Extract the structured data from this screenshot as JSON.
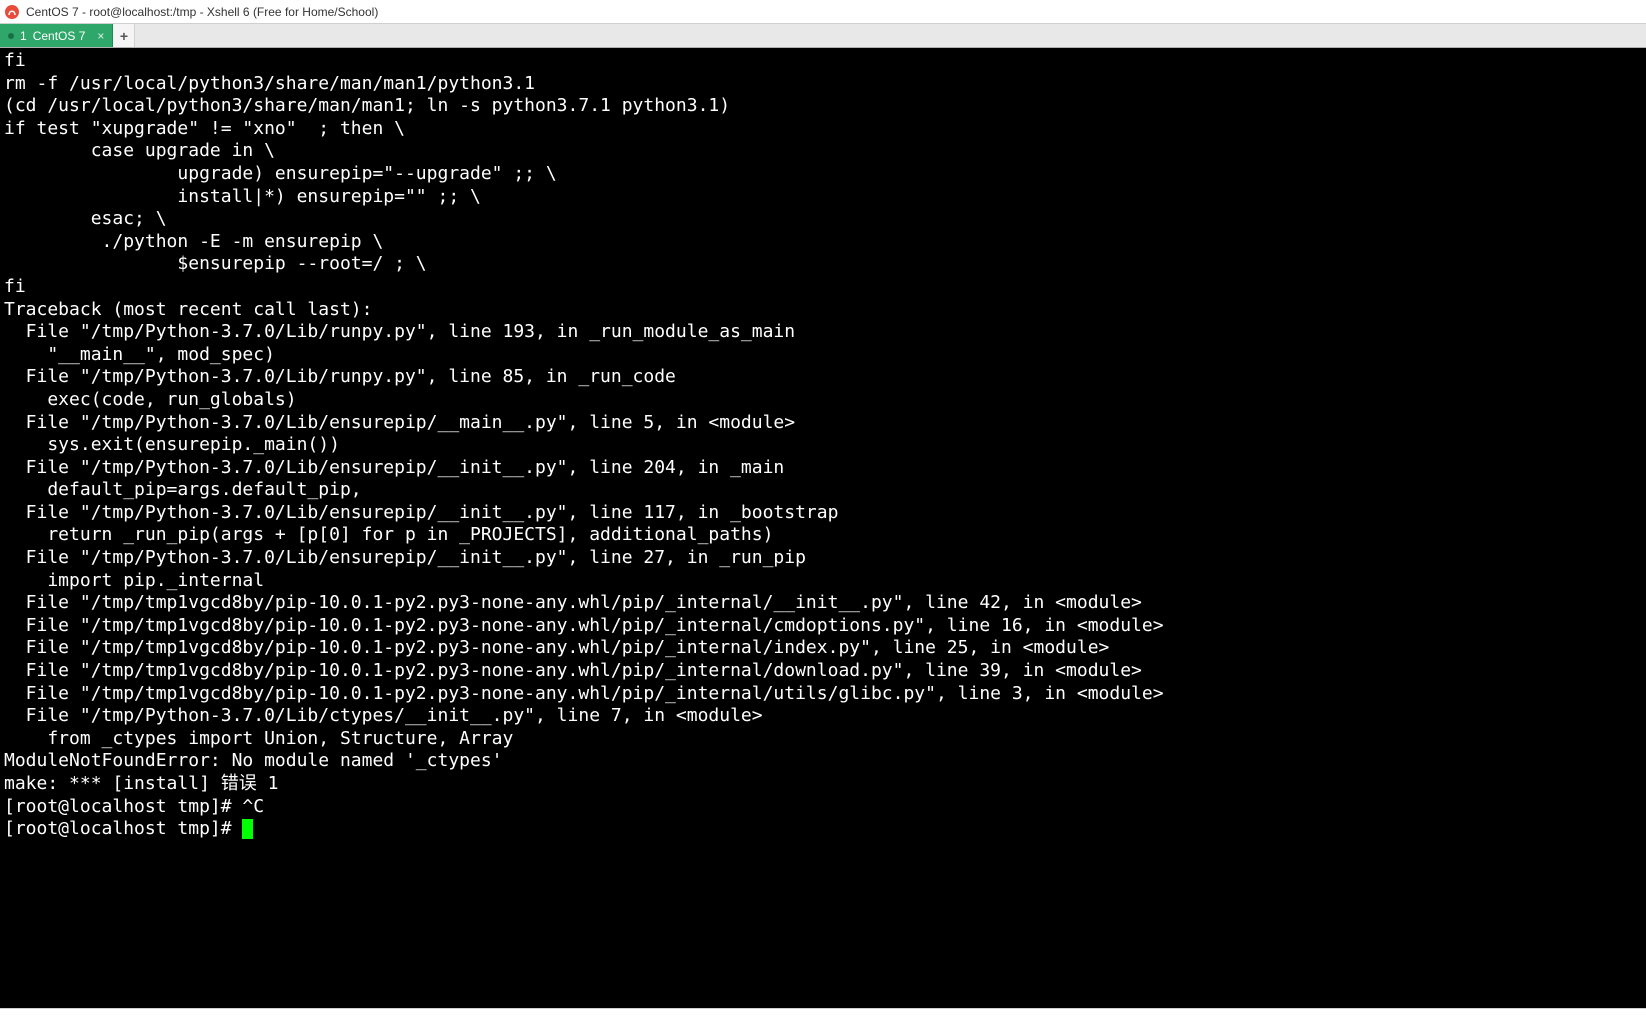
{
  "window": {
    "title": "CentOS 7 - root@localhost:/tmp - Xshell 6 (Free for Home/School)"
  },
  "tabs": {
    "active": {
      "index": "1",
      "label": "CentOS 7"
    }
  },
  "terminal": {
    "lines": [
      "fi",
      "rm -f /usr/local/python3/share/man/man1/python3.1",
      "(cd /usr/local/python3/share/man/man1; ln -s python3.7.1 python3.1)",
      "if test \"xupgrade\" != \"xno\"  ; then \\",
      "        case upgrade in \\",
      "                upgrade) ensurepip=\"--upgrade\" ;; \\",
      "                install|*) ensurepip=\"\" ;; \\",
      "        esac; \\",
      "         ./python -E -m ensurepip \\",
      "                $ensurepip --root=/ ; \\",
      "fi",
      "Traceback (most recent call last):",
      "  File \"/tmp/Python-3.7.0/Lib/runpy.py\", line 193, in _run_module_as_main",
      "    \"__main__\", mod_spec)",
      "  File \"/tmp/Python-3.7.0/Lib/runpy.py\", line 85, in _run_code",
      "    exec(code, run_globals)",
      "  File \"/tmp/Python-3.7.0/Lib/ensurepip/__main__.py\", line 5, in <module>",
      "    sys.exit(ensurepip._main())",
      "  File \"/tmp/Python-3.7.0/Lib/ensurepip/__init__.py\", line 204, in _main",
      "    default_pip=args.default_pip,",
      "  File \"/tmp/Python-3.7.0/Lib/ensurepip/__init__.py\", line 117, in _bootstrap",
      "    return _run_pip(args + [p[0] for p in _PROJECTS], additional_paths)",
      "  File \"/tmp/Python-3.7.0/Lib/ensurepip/__init__.py\", line 27, in _run_pip",
      "    import pip._internal",
      "  File \"/tmp/tmp1vgcd8by/pip-10.0.1-py2.py3-none-any.whl/pip/_internal/__init__.py\", line 42, in <module>",
      "  File \"/tmp/tmp1vgcd8by/pip-10.0.1-py2.py3-none-any.whl/pip/_internal/cmdoptions.py\", line 16, in <module>",
      "  File \"/tmp/tmp1vgcd8by/pip-10.0.1-py2.py3-none-any.whl/pip/_internal/index.py\", line 25, in <module>",
      "  File \"/tmp/tmp1vgcd8by/pip-10.0.1-py2.py3-none-any.whl/pip/_internal/download.py\", line 39, in <module>",
      "  File \"/tmp/tmp1vgcd8by/pip-10.0.1-py2.py3-none-any.whl/pip/_internal/utils/glibc.py\", line 3, in <module>",
      "  File \"/tmp/Python-3.7.0/Lib/ctypes/__init__.py\", line 7, in <module>",
      "    from _ctypes import Union, Structure, Array",
      "ModuleNotFoundError: No module named '_ctypes'",
      "make: *** [install] 错误 1",
      "[root@localhost tmp]# ^C"
    ],
    "prompt_line": "[root@localhost tmp]# "
  }
}
